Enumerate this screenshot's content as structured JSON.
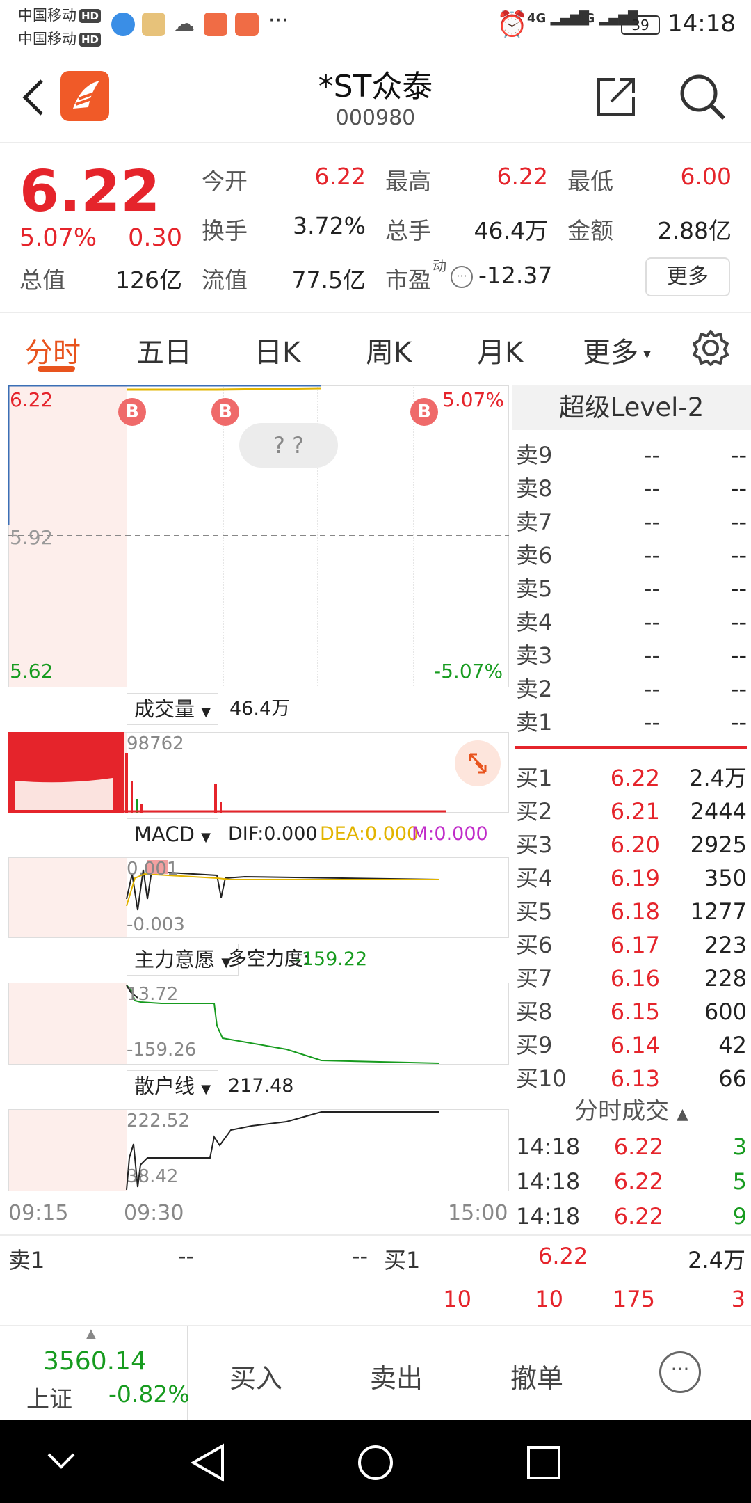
{
  "status_bar": {
    "carrier1": "中国移动",
    "carrier2": "中国移动",
    "hd": "HD",
    "network": "4G",
    "battery": "39",
    "time": "14:18",
    "more": "···"
  },
  "header": {
    "title": "*ST众泰",
    "code": "000980"
  },
  "quote": {
    "price": "6.22",
    "change_pct": "5.07%",
    "change": "0.30",
    "open_label": "今开",
    "open": "6.22",
    "high_label": "最高",
    "high": "6.22",
    "low_label": "最低",
    "low": "6.00",
    "turnover_label": "换手",
    "turnover": "3.72%",
    "volume_label": "总手",
    "volume": "46.4万",
    "amount_label": "金额",
    "amount": "2.88亿",
    "mktcap_label": "总值",
    "mktcap": "126亿",
    "float_label": "流值",
    "float": "77.5亿",
    "pe_label": "市盈",
    "pe_sup": "动",
    "pe": "-12.37",
    "more_button": "更多"
  },
  "tabs": [
    "分时",
    "五日",
    "日K",
    "周K",
    "月K",
    "更多"
  ],
  "chart": {
    "price_high": "6.22",
    "price_mid": "5.92",
    "price_low": "5.62",
    "pct_high": "5.07%",
    "pct_low": "-5.07%",
    "hint": "? ?",
    "buy_marker": "B",
    "volume_label": "成交量",
    "volume_value": "46.4万",
    "volume_max": "98762",
    "macd_label": "MACD",
    "dif": "DIF:0.000",
    "dea": "DEA:0.000",
    "m": "M:0.000",
    "macd_high": "0.001",
    "macd_low": "-0.003",
    "main_label": "主力意愿",
    "main_text": "多空力度:",
    "main_value": "-159.22",
    "main_high": "13.72",
    "main_low": "-159.26",
    "retail_label": "散户线",
    "retail_value": "217.48",
    "retail_high": "222.52",
    "retail_low": "38.42",
    "time_start": "09:15",
    "time_open": "09:30",
    "time_end": "15:00",
    "colors": {
      "up": "#e5242b",
      "down": "#179b1f",
      "accent": "#e8541e"
    }
  },
  "orderbook": {
    "title": "超级Level-2",
    "sells": [
      {
        "label": "卖9",
        "price": "--",
        "vol": "--"
      },
      {
        "label": "卖8",
        "price": "--",
        "vol": "--"
      },
      {
        "label": "卖7",
        "price": "--",
        "vol": "--"
      },
      {
        "label": "卖6",
        "price": "--",
        "vol": "--"
      },
      {
        "label": "卖5",
        "price": "--",
        "vol": "--"
      },
      {
        "label": "卖4",
        "price": "--",
        "vol": "--"
      },
      {
        "label": "卖3",
        "price": "--",
        "vol": "--"
      },
      {
        "label": "卖2",
        "price": "--",
        "vol": "--"
      },
      {
        "label": "卖1",
        "price": "--",
        "vol": "--"
      }
    ],
    "buys": [
      {
        "label": "买1",
        "price": "6.22",
        "vol": "2.4万"
      },
      {
        "label": "买2",
        "price": "6.21",
        "vol": "2444"
      },
      {
        "label": "买3",
        "price": "6.20",
        "vol": "2925"
      },
      {
        "label": "买4",
        "price": "6.19",
        "vol": "350"
      },
      {
        "label": "买5",
        "price": "6.18",
        "vol": "1277"
      },
      {
        "label": "买6",
        "price": "6.17",
        "vol": "223"
      },
      {
        "label": "买7",
        "price": "6.16",
        "vol": "228"
      },
      {
        "label": "买8",
        "price": "6.15",
        "vol": "600"
      },
      {
        "label": "买9",
        "price": "6.14",
        "vol": "42"
      },
      {
        "label": "买10",
        "price": "6.13",
        "vol": "66"
      }
    ],
    "trades_title": "分时成交",
    "trades": [
      {
        "time": "14:18",
        "price": "6.22",
        "vol": "3"
      },
      {
        "time": "14:18",
        "price": "6.22",
        "vol": "5"
      },
      {
        "time": "14:18",
        "price": "6.22",
        "vol": "9"
      }
    ]
  },
  "summary": {
    "sell1_label": "卖1",
    "sell1_price": "--",
    "sell1_vol": "--",
    "buy1_label": "买1",
    "buy1_price": "6.22",
    "buy1_vol": "2.4万",
    "queue": [
      "10",
      "10",
      "175",
      "3"
    ]
  },
  "bottom": {
    "index_value": "3560.14",
    "index_name": "上证",
    "index_change": "-0.82%",
    "buy": "买入",
    "sell": "卖出",
    "cancel": "撤单"
  }
}
